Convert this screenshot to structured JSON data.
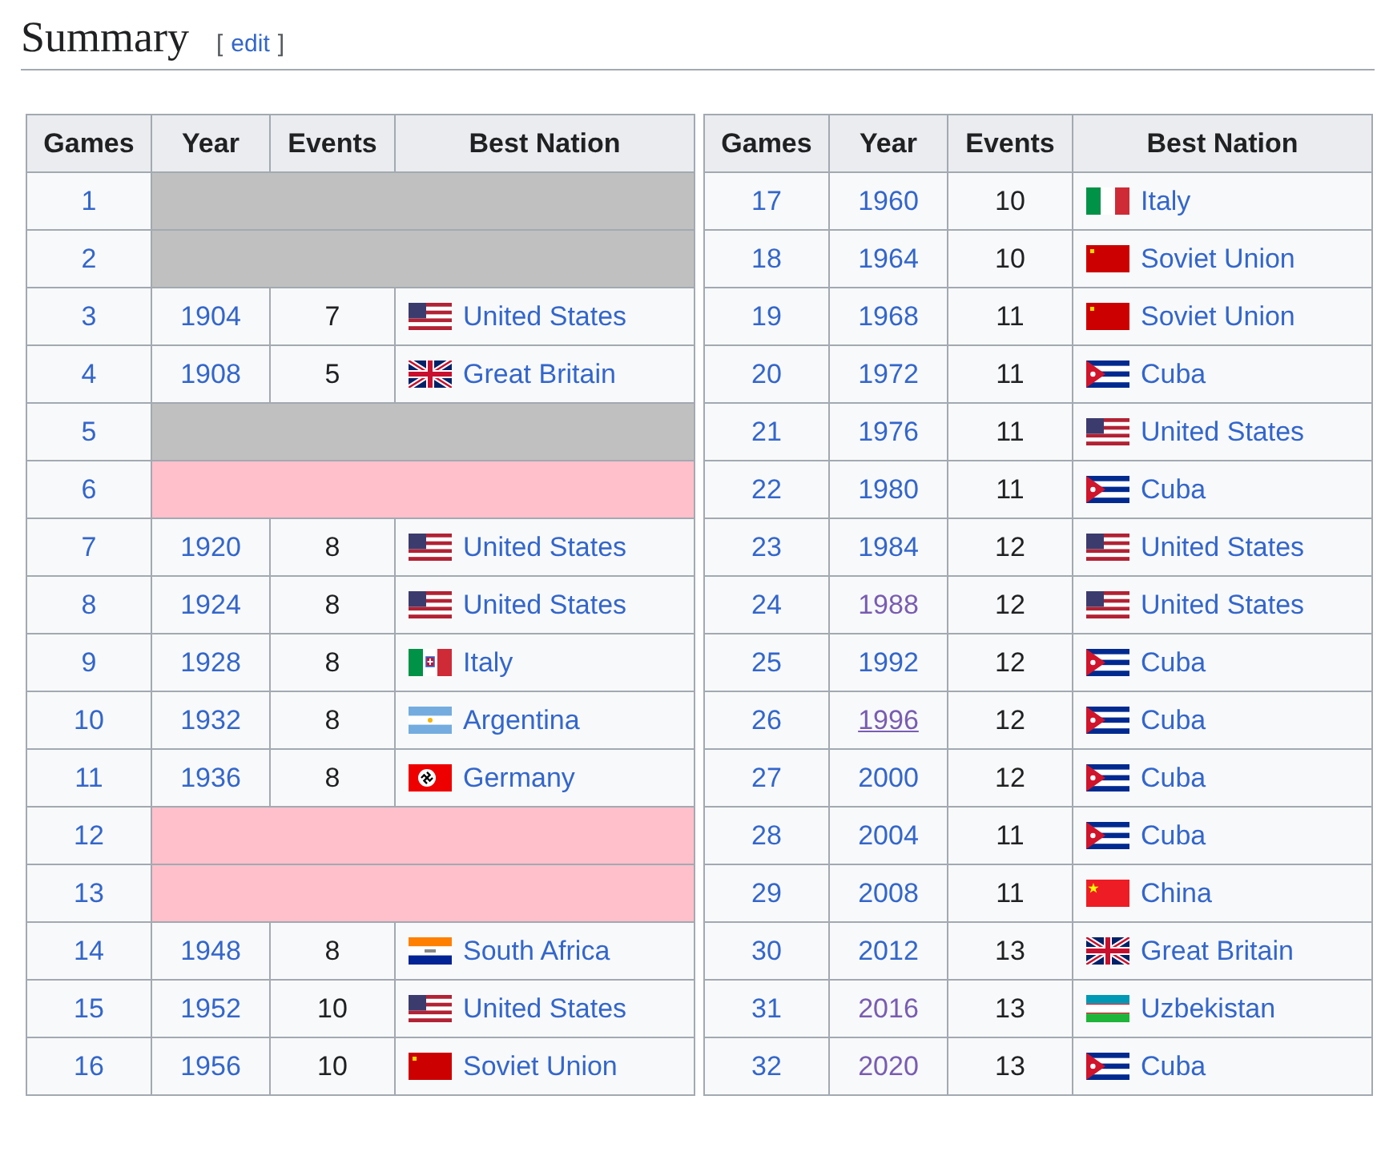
{
  "heading": {
    "title": "Summary",
    "edit_open": "[",
    "edit_label": "edit",
    "edit_close": "]"
  },
  "tables": [
    {
      "columns": [
        "Games",
        "Year",
        "Events",
        "Best Nation"
      ],
      "rows": [
        {
          "games": "1",
          "kind": "not_held"
        },
        {
          "games": "2",
          "kind": "not_held"
        },
        {
          "games": "3",
          "kind": "result",
          "year": "1904",
          "events": "7",
          "nation": "United States",
          "flag": {
            "kind": "usa"
          },
          "year_visited": false,
          "year_hovered": false
        },
        {
          "games": "4",
          "kind": "result",
          "year": "1908",
          "events": "5",
          "nation": "Great Britain",
          "flag": {
            "kind": "gbr"
          },
          "year_visited": false,
          "year_hovered": false
        },
        {
          "games": "5",
          "kind": "not_held"
        },
        {
          "games": "6",
          "kind": "cancelled"
        },
        {
          "games": "7",
          "kind": "result",
          "year": "1920",
          "events": "8",
          "nation": "United States",
          "flag": {
            "kind": "usa"
          },
          "year_visited": false,
          "year_hovered": false
        },
        {
          "games": "8",
          "kind": "result",
          "year": "1924",
          "events": "8",
          "nation": "United States",
          "flag": {
            "kind": "usa"
          },
          "year_visited": false,
          "year_hovered": false
        },
        {
          "games": "9",
          "kind": "result",
          "year": "1928",
          "events": "8",
          "nation": "Italy",
          "flag": {
            "kind": "ita_kingdom"
          },
          "year_visited": false,
          "year_hovered": false
        },
        {
          "games": "10",
          "kind": "result",
          "year": "1932",
          "events": "8",
          "nation": "Argentina",
          "flag": {
            "kind": "arg"
          },
          "year_visited": false,
          "year_hovered": false
        },
        {
          "games": "11",
          "kind": "result",
          "year": "1936",
          "events": "8",
          "nation": "Germany",
          "flag": {
            "kind": "ger_1936"
          },
          "year_visited": false,
          "year_hovered": false
        },
        {
          "games": "12",
          "kind": "cancelled"
        },
        {
          "games": "13",
          "kind": "cancelled"
        },
        {
          "games": "14",
          "kind": "result",
          "year": "1948",
          "events": "8",
          "nation": "South Africa",
          "flag": {
            "kind": "rsa"
          },
          "year_visited": false,
          "year_hovered": false
        },
        {
          "games": "15",
          "kind": "result",
          "year": "1952",
          "events": "10",
          "nation": "United States",
          "flag": {
            "kind": "usa"
          },
          "year_visited": false,
          "year_hovered": false
        },
        {
          "games": "16",
          "kind": "result",
          "year": "1956",
          "events": "10",
          "nation": "Soviet Union",
          "flag": {
            "kind": "urs"
          },
          "year_visited": false,
          "year_hovered": false
        }
      ]
    },
    {
      "columns": [
        "Games",
        "Year",
        "Events",
        "Best Nation"
      ],
      "rows": [
        {
          "games": "17",
          "kind": "result",
          "year": "1960",
          "events": "10",
          "nation": "Italy",
          "flag": {
            "kind": "ita"
          },
          "year_visited": false,
          "year_hovered": false
        },
        {
          "games": "18",
          "kind": "result",
          "year": "1964",
          "events": "10",
          "nation": "Soviet Union",
          "flag": {
            "kind": "urs"
          },
          "year_visited": false,
          "year_hovered": false
        },
        {
          "games": "19",
          "kind": "result",
          "year": "1968",
          "events": "11",
          "nation": "Soviet Union",
          "flag": {
            "kind": "urs"
          },
          "year_visited": false,
          "year_hovered": false
        },
        {
          "games": "20",
          "kind": "result",
          "year": "1972",
          "events": "11",
          "nation": "Cuba",
          "flag": {
            "kind": "cub"
          },
          "year_visited": false,
          "year_hovered": false
        },
        {
          "games": "21",
          "kind": "result",
          "year": "1976",
          "events": "11",
          "nation": "United States",
          "flag": {
            "kind": "usa"
          },
          "year_visited": false,
          "year_hovered": false
        },
        {
          "games": "22",
          "kind": "result",
          "year": "1980",
          "events": "11",
          "nation": "Cuba",
          "flag": {
            "kind": "cub"
          },
          "year_visited": false,
          "year_hovered": false
        },
        {
          "games": "23",
          "kind": "result",
          "year": "1984",
          "events": "12",
          "nation": "United States",
          "flag": {
            "kind": "usa"
          },
          "year_visited": false,
          "year_hovered": false
        },
        {
          "games": "24",
          "kind": "result",
          "year": "1988",
          "events": "12",
          "nation": "United States",
          "flag": {
            "kind": "usa"
          },
          "year_visited": true,
          "year_hovered": false
        },
        {
          "games": "25",
          "kind": "result",
          "year": "1992",
          "events": "12",
          "nation": "Cuba",
          "flag": {
            "kind": "cub"
          },
          "year_visited": false,
          "year_hovered": false
        },
        {
          "games": "26",
          "kind": "result",
          "year": "1996",
          "events": "12",
          "nation": "Cuba",
          "flag": {
            "kind": "cub"
          },
          "year_visited": true,
          "year_hovered": true
        },
        {
          "games": "27",
          "kind": "result",
          "year": "2000",
          "events": "12",
          "nation": "Cuba",
          "flag": {
            "kind": "cub"
          },
          "year_visited": false,
          "year_hovered": false
        },
        {
          "games": "28",
          "kind": "result",
          "year": "2004",
          "events": "11",
          "nation": "Cuba",
          "flag": {
            "kind": "cub"
          },
          "year_visited": false,
          "year_hovered": false
        },
        {
          "games": "29",
          "kind": "result",
          "year": "2008",
          "events": "11",
          "nation": "China",
          "flag": {
            "kind": "chn"
          },
          "year_visited": false,
          "year_hovered": false
        },
        {
          "games": "30",
          "kind": "result",
          "year": "2012",
          "events": "13",
          "nation": "Great Britain",
          "flag": {
            "kind": "gbr"
          },
          "year_visited": false,
          "year_hovered": false
        },
        {
          "games": "31",
          "kind": "result",
          "year": "2016",
          "events": "13",
          "nation": "Uzbekistan",
          "flag": {
            "kind": "uzb"
          },
          "year_visited": true,
          "year_hovered": false
        },
        {
          "games": "32",
          "kind": "result",
          "year": "2020",
          "events": "13",
          "nation": "Cuba",
          "flag": {
            "kind": "cub"
          },
          "year_visited": true,
          "year_hovered": false
        }
      ]
    }
  ]
}
